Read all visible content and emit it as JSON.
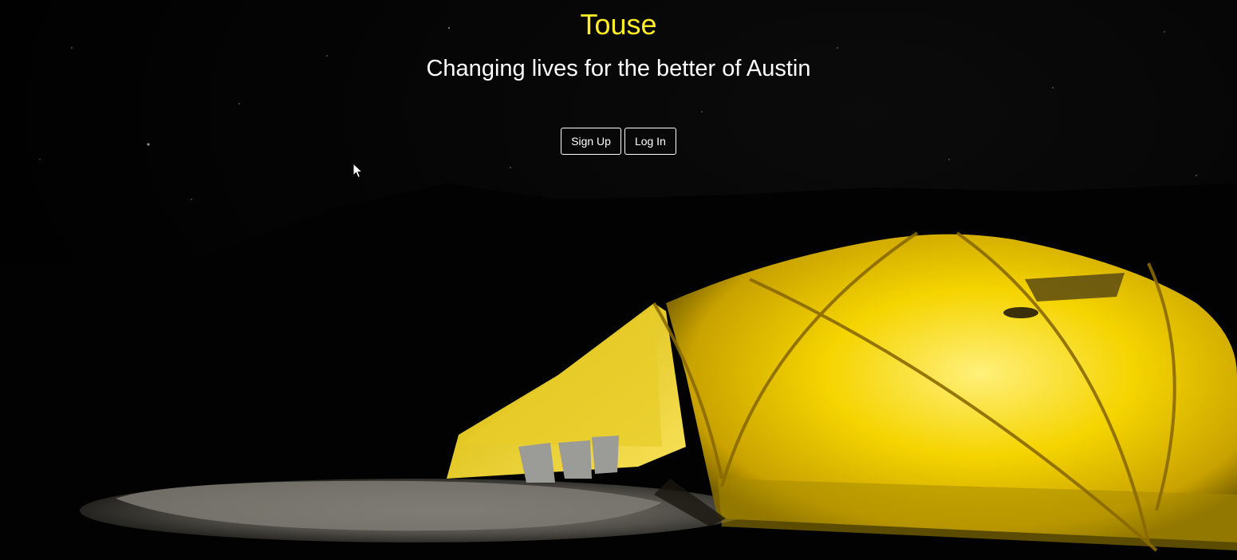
{
  "hero": {
    "title": "Touse",
    "tagline": "Changing lives for the better of Austin",
    "title_color": "#ffee22"
  },
  "actions": {
    "signup_label": "Sign Up",
    "login_label": "Log In"
  },
  "background": {
    "description_icon": "camping-tent-night-image"
  }
}
